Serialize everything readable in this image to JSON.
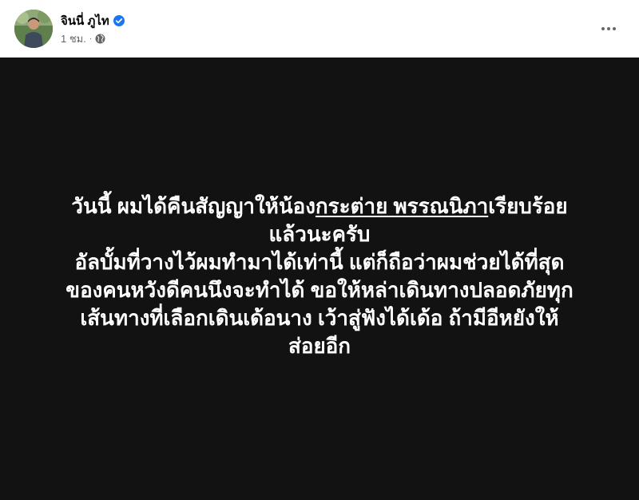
{
  "post": {
    "author": {
      "name": "จินนี่ ภูไท",
      "verified": true,
      "avatar_icon": "profile-photo"
    },
    "meta": {
      "time": "1 ชม.",
      "separator": "·",
      "privacy_icon": "globe-icon"
    },
    "more_icon": "more-options-icon",
    "body": {
      "background": "#121212",
      "text_color": "#ffffff",
      "line1_prefix": "วันนี้ ผมได้คืนสัญญาให้น้อง",
      "mention": "กระต่าย พรรณนิภา",
      "line1_suffix": "เรียบร้อย",
      "line2": "แล้วนะครับ",
      "line3": "อัลบั้มที่วางไว้ผมทำมาได้เท่านี้ แต่ก็ถือว่าผมช่วยได้ที่สุด",
      "line4": "ของคนหวังดีคนนึงจะทำได้ ขอให้หล่าเดินทางปลอดภัยทุก",
      "line5": "เส้นทางที่เลือกเดินเด้อนาง เว้าสู่ฟังได้เด้อ ถ้ามีอีหยังให้",
      "line6": "ส่อยอีก"
    }
  },
  "colors": {
    "verified_blue": "#1877f2",
    "meta_gray": "#65676b"
  }
}
